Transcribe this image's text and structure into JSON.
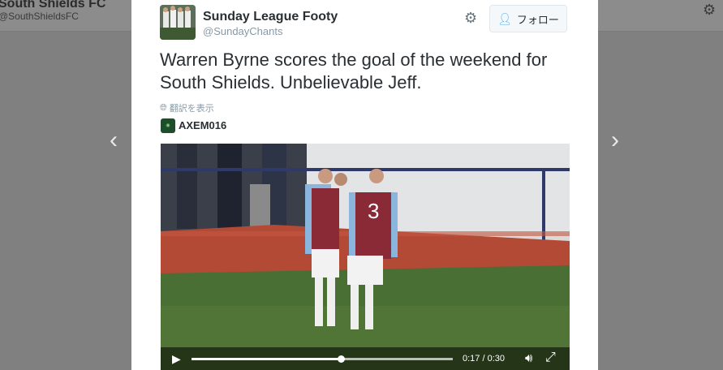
{
  "background": {
    "profile_name": "South Shields FC",
    "profile_handle": "@SouthShieldsFC",
    "gear_icon": "gear-icon"
  },
  "tweet": {
    "author_name": "Sunday League Footy",
    "author_handle": "@SundayChants",
    "follow_label": "フォロー",
    "text": "Warren Byrne scores the goal of the weekend for South Shields. Unbelievable Jeff.",
    "translate_label": "翻訳を表示",
    "quote_user": "AXEM016"
  },
  "video": {
    "progress": 0.57,
    "time": "0:17 / 0:30"
  },
  "colors": {
    "link_blue": "#55acee",
    "text_dark": "#292f33",
    "text_gray": "#8899a6"
  }
}
